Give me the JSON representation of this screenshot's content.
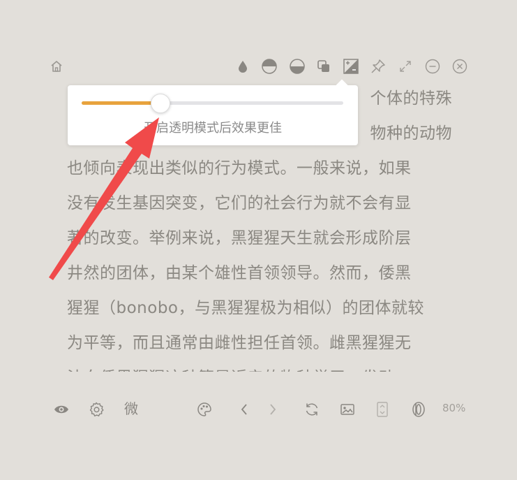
{
  "reading": {
    "lines": [
      "个体的特殊",
      "物种的动物",
      "也倾向表现出类似的行为模式。一般来说，如果",
      "没有发生基因突变，它们的社会行为就不会有显",
      "著的改变。举例来说，黑猩猩天生就会形成阶层",
      "井然的团体，由某个雄性首领领导。然而，倭黑",
      "猩猩（bonobo，与黑猩猩极为相似）的团体就较",
      "为平等，而且通常由雌性担任首领。雌黑猩猩无",
      "法向倭黑猩猩这种算是近亲的物种学习，发动—"
    ]
  },
  "popup": {
    "hint": "开启透明模式后效果更佳",
    "slider_value": 0.3
  },
  "bottom_toolbar": {
    "weibo_label": "微",
    "zoom": "80%"
  },
  "icons": {
    "top": [
      "home-icon",
      "water-drop-icon",
      "half-circle-top-icon",
      "half-circle-bottom-icon",
      "copy-icon",
      "brightness-contrast-icon",
      "pin-icon",
      "expand-icon",
      "minimize-icon",
      "close-icon"
    ],
    "bottom": [
      "eye-icon",
      "gear-icon",
      "weibo-icon",
      "palette-icon",
      "chevron-left-icon",
      "chevron-right-icon",
      "refresh-icon",
      "image-icon",
      "page-icon",
      "scroll-icon"
    ]
  },
  "colors": {
    "background": "#e2dfda",
    "slider_fill": "#e8a33d",
    "arrow": "#f04a4a",
    "text": "#8b8882"
  }
}
